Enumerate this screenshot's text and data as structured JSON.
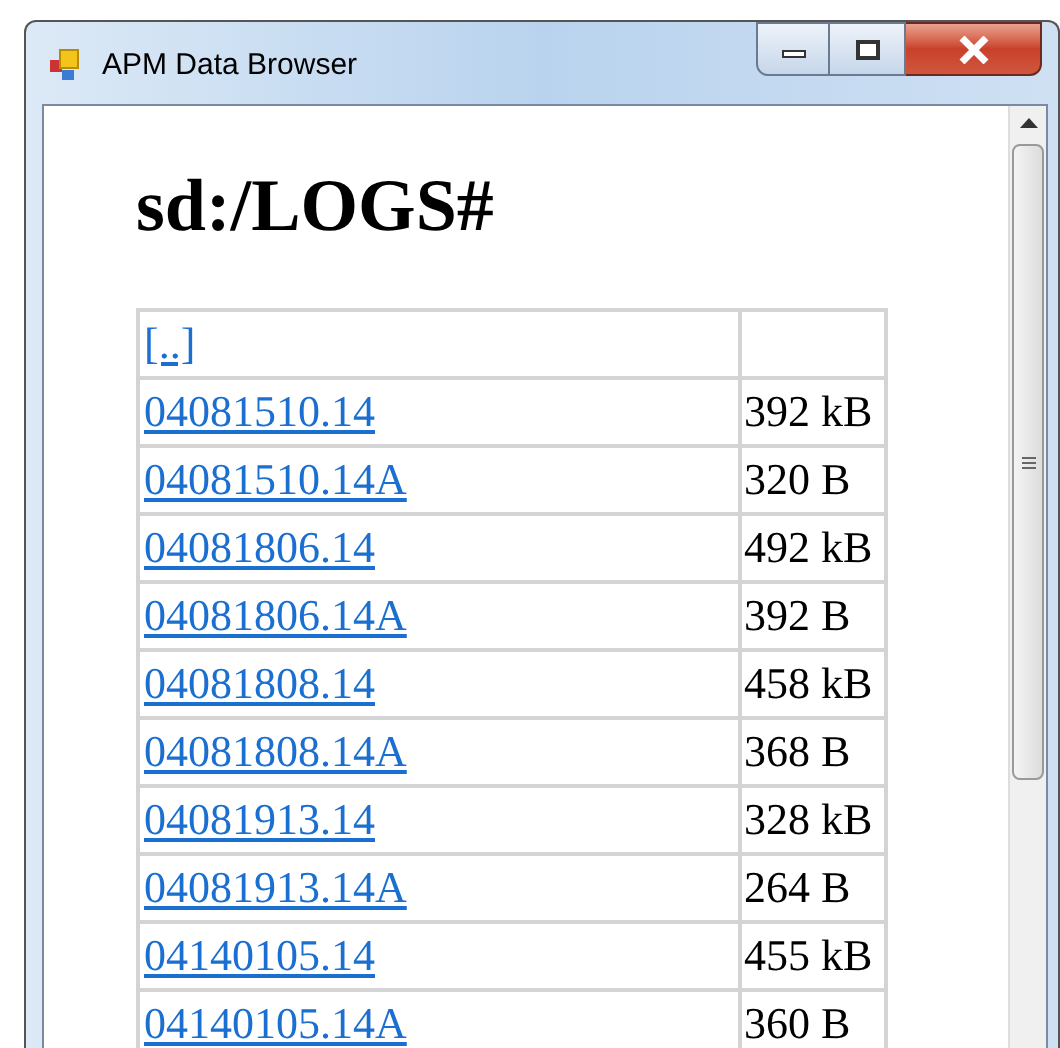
{
  "window": {
    "title": "APM Data Browser"
  },
  "heading": "sd:/LOGS#",
  "table": {
    "rows": [
      {
        "name": "[..]",
        "size": ""
      },
      {
        "name": "04081510.14",
        "size": "392 kB"
      },
      {
        "name": "04081510.14A",
        "size": "320 B"
      },
      {
        "name": "04081806.14",
        "size": "492 kB"
      },
      {
        "name": "04081806.14A",
        "size": "392 B"
      },
      {
        "name": "04081808.14",
        "size": "458 kB"
      },
      {
        "name": "04081808.14A",
        "size": "368 B"
      },
      {
        "name": "04081913.14",
        "size": "328 kB"
      },
      {
        "name": "04081913.14A",
        "size": "264 B"
      },
      {
        "name": "04140105.14",
        "size": "455 kB"
      },
      {
        "name": "04140105.14A",
        "size": "360 B"
      }
    ]
  }
}
